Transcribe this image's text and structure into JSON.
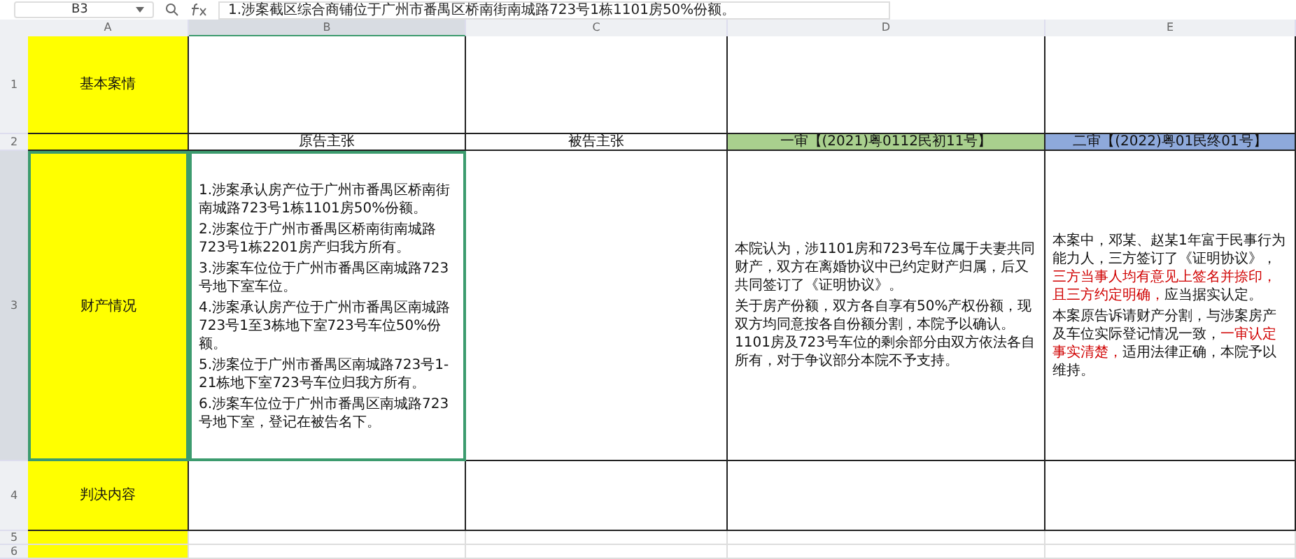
{
  "toolbar": {
    "cell_ref": "B3",
    "formula": "1.涉案截区综合商铺位于广州市番禺区桥南街南城路723号1栋1101房50%份额。"
  },
  "columns": [
    {
      "label": "A",
      "selected": false
    },
    {
      "label": "B",
      "selected": true
    },
    {
      "label": "C",
      "selected": false
    },
    {
      "label": "D",
      "selected": false
    },
    {
      "label": "E",
      "selected": false
    }
  ],
  "rows": [
    {
      "number": "1",
      "selected": false,
      "cells": [
        {
          "text": "基本案情",
          "color": "#ffff00",
          "selected": false
        },
        {
          "selected": false
        },
        {
          "selected": false
        },
        {
          "selected": false
        },
        {
          "selected": false
        }
      ]
    },
    {
      "number": "2",
      "selected": false,
      "cells": [
        {
          "color": "#ffff00",
          "selected": false
        },
        {
          "text": "原告主张",
          "selected": false
        },
        {
          "text": "被告主张",
          "selected": false
        },
        {
          "text": "一审【(2021)粤0112民初11号】",
          "color": "#a9d08e",
          "selected": false
        },
        {
          "text": "二审【(2022)粤01民终01号】",
          "color": "#8ea9db",
          "selected": false
        }
      ]
    },
    {
      "number": "3",
      "selected": true,
      "cells": [
        {
          "text": "财产情况",
          "color": "#ffff00",
          "selected": true
        },
        {
          "selected": true,
          "paragraphs": [
            [
              {
                "text": "1.涉案承认房产位于广州市番禺区桥南街南城路723号1栋1101房50%份额。",
                "kind": "plain"
              }
            ],
            [
              {
                "text": "2.涉案位于广州市番禺区桥南街南城路723号1栋2201房产归我方所有。",
                "kind": "plain"
              }
            ],
            [
              {
                "text": "3.涉案车位位于广州市番禺区南城路723号地下室车位。",
                "kind": "plain"
              }
            ],
            [
              {
                "text": "4.涉案承认房产位于广州市番禺区南城路723号1至3栋地下室723号车位50%份额。",
                "kind": "plain"
              }
            ],
            [
              {
                "text": "5.涉案位于广州市番禺区南城路723号1-21栋地下室723号车位归我方所有。",
                "kind": "plain"
              }
            ],
            [
              {
                "text": "6.涉案车位位于广州市番禺区南城路723号地下室，登记在被告名下。",
                "kind": "plain"
              }
            ]
          ]
        },
        {
          "selected": false
        },
        {
          "selected": false,
          "paragraphs": [
            [
              {
                "text": "本院认为，涉1101房和723号车位属于夫妻共同财产，双方在离婚协议中已约定财产归属，后又共同签订了《证明协议》。",
                "kind": "plain"
              }
            ],
            [
              {
                "text": "关于房产份额，双方各自享有50%产权份额，现双方均同意按各自份额分割，本院予以确认。1101房及723号车位的剩余部分由双方依法各自所有，对于争议部分本院不予支持。",
                "kind": "plain"
              }
            ]
          ]
        },
        {
          "selected": false,
          "paragraphs": [
            [
              {
                "text": "本案中，邓某、赵某1年富于民事行为能力人，三方签订了《证明协议》，",
                "kind": "plain"
              },
              {
                "text": "三方当事人均有意见上签名并捺印，且三方约定明确，",
                "kind": "emphasis"
              },
              {
                "text": "应当据实认定。",
                "kind": "plain"
              }
            ],
            [
              {
                "text": "本案原告诉请财产分割，与涉案房产及车位实际登记情况一致，",
                "kind": "plain"
              },
              {
                "text": "一审认定事实清楚，",
                "kind": "emphasis"
              },
              {
                "text": "适用法律正确，本院予以维持。",
                "kind": "plain"
              }
            ]
          ]
        }
      ]
    },
    {
      "number": "4",
      "selected": false,
      "cells": [
        {
          "text": "判决内容",
          "color": "#ffff00",
          "selected": false
        },
        {
          "selected": false
        },
        {
          "selected": false
        },
        {
          "selected": false
        },
        {
          "selected": false
        }
      ]
    },
    {
      "number": "5",
      "selected": false,
      "cells": [
        {
          "color": "#ffff00",
          "selected": false
        },
        {
          "selected": false
        },
        {
          "selected": false
        },
        {
          "selected": false
        },
        {
          "selected": false
        }
      ]
    },
    {
      "number": "6",
      "selected": false,
      "cells": [
        {
          "color": "#ffff00",
          "selected": false
        },
        {
          "selected": false
        },
        {
          "selected": false
        },
        {
          "selected": false
        },
        {
          "selected": false
        }
      ]
    }
  ]
}
